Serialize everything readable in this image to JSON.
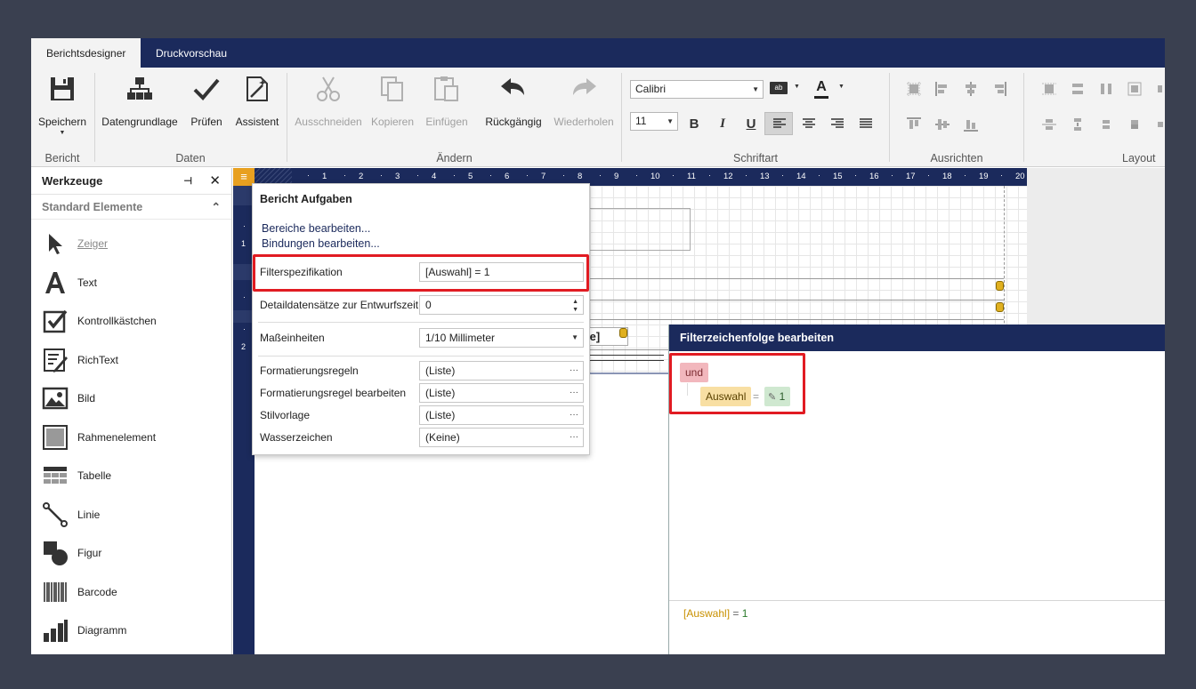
{
  "tabs": [
    {
      "label": "Berichtsdesigner",
      "active": true
    },
    {
      "label": "Druckvorschau",
      "active": false
    }
  ],
  "ribbon": {
    "groups": {
      "bericht": "Bericht",
      "daten": "Daten",
      "aendern": "Ändern",
      "schriftart": "Schriftart",
      "ausrichten": "Ausrichten",
      "layout": "Layout"
    },
    "buttons": {
      "speichern": "Speichern",
      "datengrundlage": "Datengrundlage",
      "pruefen": "Prüfen",
      "assistent": "Assistent",
      "ausschneiden": "Ausschneiden",
      "kopieren": "Kopieren",
      "einfuegen": "Einfügen",
      "rueckgaengig": "Rückgängig",
      "wiederholen": "Wiederholen"
    },
    "font_name": "Calibri",
    "font_size": "11",
    "format_labels": {
      "bold": "B",
      "italic": "I",
      "underline": "U",
      "color": "A"
    }
  },
  "toolbox": {
    "title": "Werkzeuge",
    "pin": "⊣",
    "close": "✕",
    "category": "Standard Elemente",
    "items": [
      {
        "label": "Zeiger"
      },
      {
        "label": "Text"
      },
      {
        "label": "Kontrollkästchen"
      },
      {
        "label": "RichText"
      },
      {
        "label": "Bild"
      },
      {
        "label": "Rahmenelement"
      },
      {
        "label": "Tabelle"
      },
      {
        "label": "Linie"
      },
      {
        "label": "Figur"
      },
      {
        "label": "Barcode"
      },
      {
        "label": "Diagramm"
      }
    ]
  },
  "ruler": {
    "h_ticks": [
      "1",
      "2",
      "3",
      "4",
      "5",
      "6",
      "7",
      "8",
      "9",
      "10",
      "11",
      "12",
      "13",
      "14",
      "15",
      "16",
      "17",
      "18",
      "19",
      "20"
    ],
    "v_ticks": [
      "1",
      "2"
    ]
  },
  "task_panel": {
    "title": "Bericht Aufgaben",
    "links": [
      "Bereiche bearbeiten...",
      "Bindungen bearbeiten..."
    ],
    "rows": [
      {
        "label": "Filterspezifikation",
        "value": "[Auswahl] = 1"
      },
      {
        "label": "Detaildatensätze zur Entwurfszeit",
        "value": "0"
      },
      {
        "label": "Maßeinheiten",
        "value": "1/10 Millimeter"
      },
      {
        "label": "Formatierungsregeln",
        "value": "(Liste)"
      },
      {
        "label": "Formatierungsregel bearbeiten",
        "value": "(Liste)"
      },
      {
        "label": "Stilvorlage",
        "value": "(Liste)"
      },
      {
        "label": "Wasserzeichen",
        "value": "(Keine)"
      }
    ],
    "ellipsis": "···"
  },
  "canvas_fragment": "le]",
  "filter_window": {
    "title": "Filterzeichenfolge bearbeiten",
    "group_op": "und",
    "field": "Auswahl",
    "operator": "=",
    "value": "1",
    "expression_field": "[Auswahl]",
    "expression_rest": " = ",
    "expression_value": "1"
  },
  "colors": {
    "navy": "#1b2a5c",
    "red_highlight": "#e11b22",
    "orange": "#e8a020"
  }
}
